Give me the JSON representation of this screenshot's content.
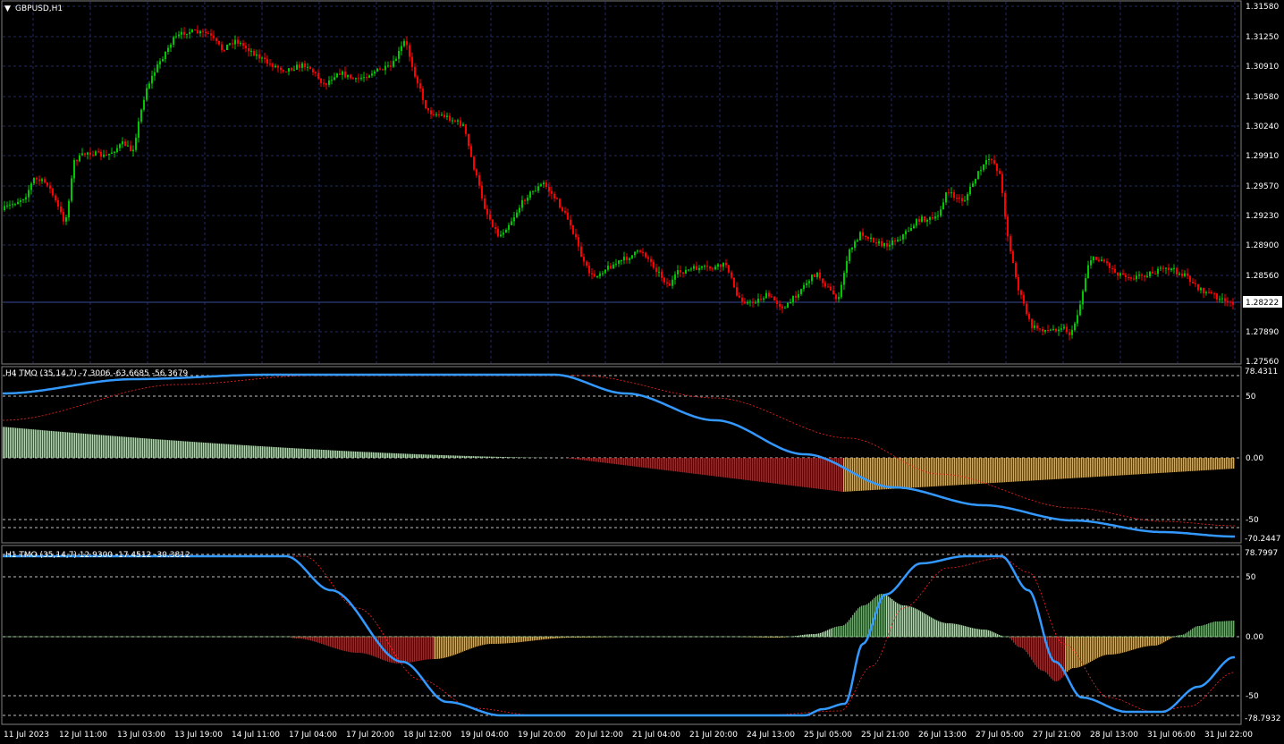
{
  "window": {
    "symbol_title": "GBPUSD,H1",
    "dropdown_glyph": "▼"
  },
  "main_panel": {
    "price_axis": [
      "1.31580",
      "1.31250",
      "1.30910",
      "1.30580",
      "1.30240",
      "1.29910",
      "1.29570",
      "1.29230",
      "1.28900",
      "1.28560",
      "1.28222",
      "1.27890",
      "1.27560"
    ],
    "current_price": "1.28222",
    "current_price_color": "#ffffff",
    "bull_candle_color": "#00c800",
    "bear_candle_color": "#ff0000",
    "grid_color": "#1c2a6e"
  },
  "indicator_h4": {
    "title": "H4 TMO (35,14,7) -7.3006 -63.6685 -56.3679",
    "axis_top": "78.4311",
    "axis_levels": [
      "50",
      "0.00",
      "-50"
    ],
    "axis_bottom": "-70.2447"
  },
  "indicator_h1": {
    "title": "H1 TMO (35,14,7) 12.9300 -17.4512 -30.3812",
    "axis_top": "78.7997",
    "axis_levels": [
      "50",
      "0.00",
      "-50"
    ],
    "axis_bottom": "-78.7932"
  },
  "time_axis": [
    "11 Jul 2023",
    "12 Jul 11:00",
    "13 Jul 03:00",
    "13 Jul 19:00",
    "14 Jul 11:00",
    "17 Jul 04:00",
    "17 Jul 20:00",
    "18 Jul 12:00",
    "19 Jul 04:00",
    "19 Jul 20:00",
    "20 Jul 12:00",
    "21 Jul 04:00",
    "21 Jul 20:00",
    "24 Jul 13:00",
    "25 Jul 05:00",
    "25 Jul 21:00",
    "26 Jul 13:00",
    "27 Jul 05:00",
    "27 Jul 21:00",
    "28 Jul 13:00",
    "31 Jul 06:00",
    "31 Jul 22:00"
  ],
  "colors": {
    "tmo_line": "#3399ff",
    "signal_line": "#ff2020",
    "hist_light_green": "#98e898",
    "hist_green": "#40c840",
    "hist_red": "#ff0000",
    "hist_orange": "#ffa500",
    "level_line": "#c0c0c0"
  }
}
